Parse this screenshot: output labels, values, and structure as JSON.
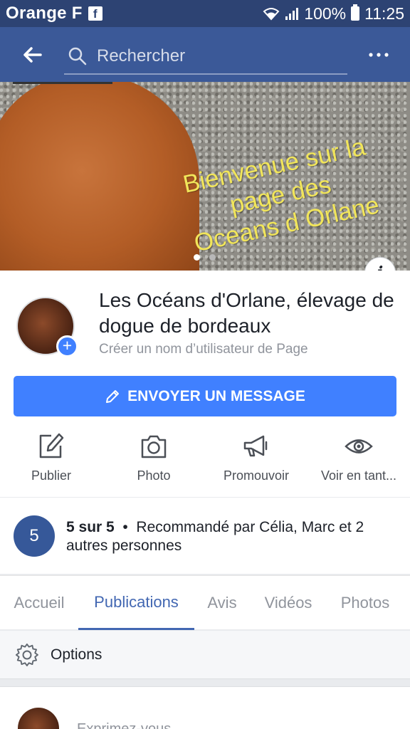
{
  "status_bar": {
    "carrier": "Orange F",
    "battery": "100%",
    "time": "11:25"
  },
  "top_bar": {
    "search_placeholder": "Rechercher"
  },
  "cover": {
    "text_line1": "Bienvenue  sur la",
    "text_line2": "page des",
    "text_line3": "Oceans d Orlane"
  },
  "profile": {
    "page_name": "Les Océans d'Orlane, élevage de dogue de bordeaux",
    "username_prompt": "Créer un nom d’utilisateur de Page",
    "message_button": "ENVOYER UN MESSAGE",
    "actions": [
      {
        "label": "Publier",
        "icon": "edit-icon"
      },
      {
        "label": "Photo",
        "icon": "camera-icon"
      },
      {
        "label": "Promouvoir",
        "icon": "megaphone-icon"
      },
      {
        "label": "Voir en tant...",
        "icon": "eye-icon"
      }
    ]
  },
  "rating": {
    "score": "5",
    "score_text": "5 sur 5",
    "separator": "•",
    "recommendation": "Recommandé par Célia, Marc et 2 autres personnes"
  },
  "tabs": [
    {
      "label": "Accueil",
      "active": false
    },
    {
      "label": "Publications",
      "active": true
    },
    {
      "label": "Avis",
      "active": false
    },
    {
      "label": "Vidéos",
      "active": false
    },
    {
      "label": "Photos",
      "active": false
    }
  ],
  "options": {
    "label": "Options"
  },
  "composer": {
    "placeholder": "Exprimez-vous"
  },
  "colors": {
    "header": "#3b5998",
    "status_bar": "#2d4373",
    "accent": "#4080ff",
    "active_tab": "#4267b2",
    "rating_circle": "#365899",
    "cover_text": "#f1e55a"
  }
}
